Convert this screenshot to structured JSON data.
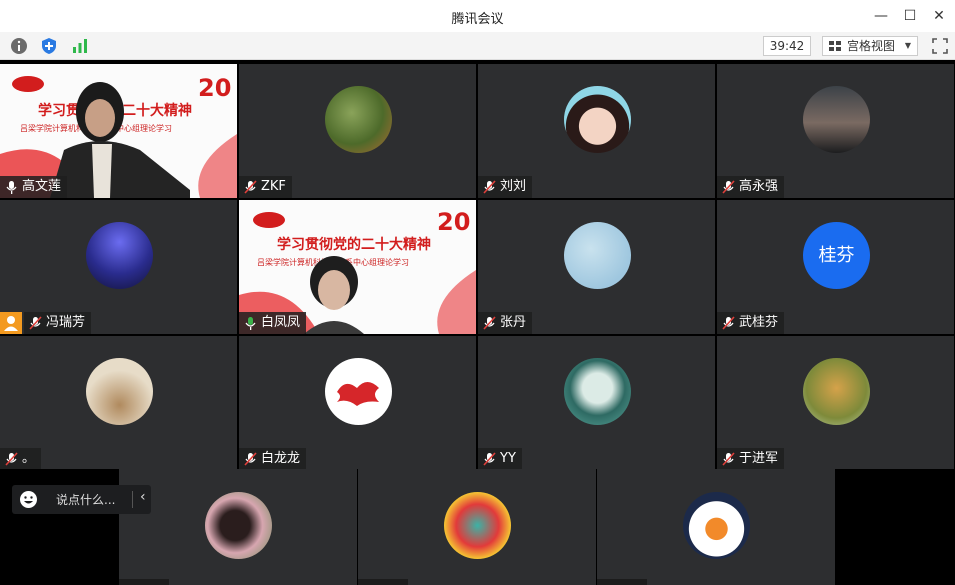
{
  "window": {
    "title": "腾讯会议"
  },
  "toolbar": {
    "timer": "39:42",
    "view_label": "宫格视图"
  },
  "participants": [
    {
      "name": "高文莲"
    },
    {
      "name": "ZKF"
    },
    {
      "name": "刘刘"
    },
    {
      "name": "高永强"
    },
    {
      "name": "冯瑞芳"
    },
    {
      "name": "白凤凤"
    },
    {
      "name": "张丹"
    },
    {
      "name": "武桂芬",
      "avatar_text": "桂芬"
    },
    {
      "name": "。"
    },
    {
      "name": "白龙龙"
    },
    {
      "name": "YY"
    },
    {
      "name": "于进军"
    }
  ],
  "slide": {
    "title": "学习贯彻党的二十大精神",
    "subtitle": "吕梁学院计算机科学技术系中心组理论学习"
  },
  "chat": {
    "placeholder": "说点什么..."
  },
  "colors": {
    "accent_blue": "#1a6cf0",
    "mic_active": "#3bb34a",
    "frame_green": "#2fa84f"
  }
}
